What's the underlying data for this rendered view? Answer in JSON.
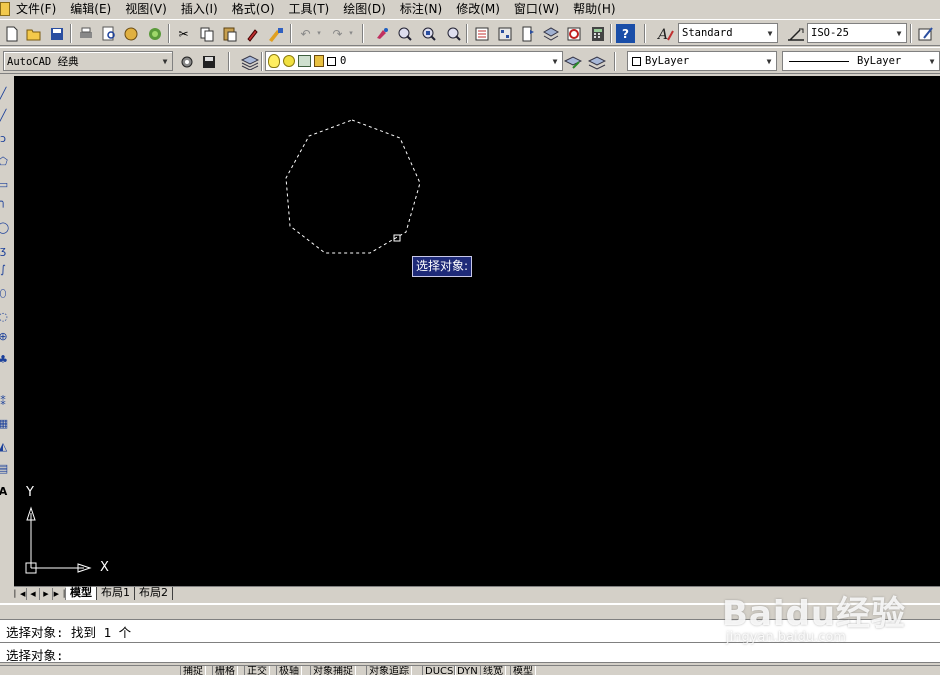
{
  "menu": [
    {
      "label": "文件(F)"
    },
    {
      "label": "编辑(E)"
    },
    {
      "label": "视图(V)"
    },
    {
      "label": "插入(I)"
    },
    {
      "label": "格式(O)"
    },
    {
      "label": "工具(T)"
    },
    {
      "label": "绘图(D)"
    },
    {
      "label": "标注(N)"
    },
    {
      "label": "修改(M)"
    },
    {
      "label": "窗口(W)"
    },
    {
      "label": "帮助(H)"
    }
  ],
  "toolbar": {
    "text_style": "Standard",
    "dim_style": "ISO-25",
    "workspace": "AutoCAD 经典",
    "layer": "0",
    "color": "ByLayer",
    "linetype": "ByLayer"
  },
  "canvas": {
    "tooltip": "选择对象:",
    "ucs_x": "X",
    "ucs_y": "Y",
    "background": "#000000",
    "selection_color": "#ffffff"
  },
  "layout_tabs": [
    {
      "label": "模型",
      "active": true
    },
    {
      "label": "布局1",
      "active": false
    },
    {
      "label": "布局2",
      "active": false
    }
  ],
  "command": {
    "history_line": "选择对象: 找到 1 个",
    "prompt_line": "选择对象:"
  },
  "statusbar": [
    {
      "label": "捕捉"
    },
    {
      "label": "栅格"
    },
    {
      "label": "正交"
    },
    {
      "label": "极轴"
    },
    {
      "label": "对象捕捉"
    },
    {
      "label": "对象追踪"
    },
    {
      "label": "DUCS"
    },
    {
      "label": "DYN"
    },
    {
      "label": "线宽"
    },
    {
      "label": "模型"
    }
  ],
  "watermark": {
    "main": "Baidu经验",
    "sub": "jingyan.baidu.com"
  }
}
